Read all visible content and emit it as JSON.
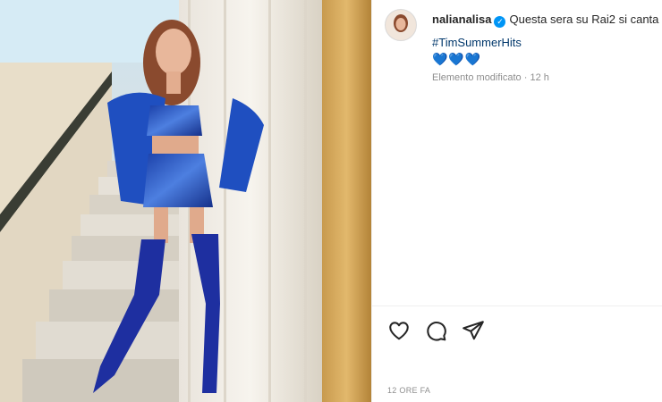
{
  "post": {
    "username": "nalianalisa",
    "caption": "Questa sera su Rai2 si canta",
    "hashtag": "#TimSummerHits",
    "hearts": "💙💙💙",
    "edited_label": "Elemento modificato",
    "separator": "·",
    "age": "12 h",
    "timestamp": "12 ORE FA"
  },
  "icons": {
    "like": "heart-outline",
    "comment": "speech-bubble",
    "share": "paper-plane",
    "verified": "check-badge"
  },
  "colors": {
    "accent": "#0095f6",
    "heart_blue": "#1d5fd0",
    "meta_gray": "#8e8e8e"
  }
}
